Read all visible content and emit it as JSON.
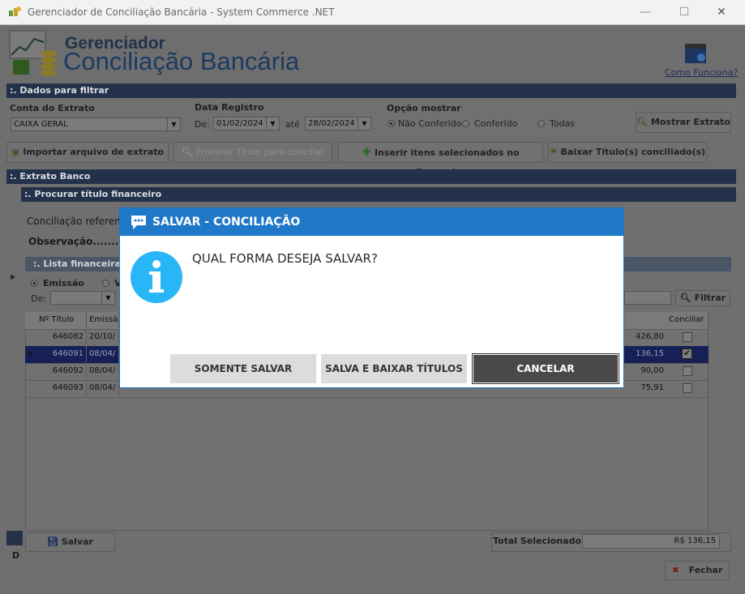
{
  "window": {
    "title": "Gerenciador de Conciliação Bancária - System Commerce .NET",
    "minimize": "—",
    "maximize": "☐",
    "close": "✕"
  },
  "header": {
    "title_line1": "Gerenciador",
    "title_line2": "Conciliação Bancária",
    "help_link": "Como Funciona?"
  },
  "filter": {
    "section": ":. Dados para filtrar",
    "conta_label": "Conta do Extrato",
    "conta_value": "CAIXA GERAL",
    "data_label": "Data Registro",
    "de_label": "De:",
    "de_value": "01/02/2024",
    "ate_label": "até",
    "ate_value": "28/02/2024",
    "opcao_label": "Opção mostrar",
    "options": [
      "Não Conferido",
      "Conferido",
      "Todas"
    ],
    "show_button": "Mostrar Extrato"
  },
  "toolbar": {
    "importar": "Importar arquivo de extrato",
    "procurar": "Procurar Título para conciliar",
    "inserir": "Inserir itens selecionados no financeiro",
    "baixar": "Baixar Título(s) conciliado(s)"
  },
  "extrato": {
    "section": ":. Extrato Banco"
  },
  "procurar": {
    "section": ":. Procurar título financeiro",
    "conciliacao_label": "Conciliação referen",
    "observacao_label": "Observação.........."
  },
  "lista": {
    "section": ":. Lista financeira p",
    "radio1": "Emissão",
    "radio2": "V",
    "de_label": "De:",
    "filtrar": "Filtrar",
    "columns": [
      "Nº Título",
      "Emissã",
      "Conciliar"
    ],
    "rows": [
      {
        "titulo": "646082",
        "emissao": "20/10/",
        "valor": "426,80",
        "checked": false
      },
      {
        "titulo": "646091",
        "emissao": "08/04/",
        "valor": "136,15",
        "checked": true
      },
      {
        "titulo": "646092",
        "emissao": "08/04/",
        "valor": "90,00",
        "checked": false
      },
      {
        "titulo": "646093",
        "emissao": "08/04/",
        "valor": "75,91",
        "checked": false
      }
    ]
  },
  "footer": {
    "salvar": "Salvar",
    "total_label": "Total Selecionado:",
    "total_value": "R$ 136,15",
    "fechar": "Fechar",
    "d_label": "D"
  },
  "dialog": {
    "title": "SALVAR - CONCILIAÇÃO",
    "message": "QUAL FORMA DESEJA SALVAR?",
    "btn_save": "SOMENTE SALVAR",
    "btn_save_lower": "SALVA E BAIXAR TÍTULOS",
    "btn_cancel": "CANCELAR"
  },
  "colors": {
    "dialog_header": "#1f78c8",
    "section_bar": "#23324a",
    "selected_row": "#1a237e",
    "info_icon": "#29b6f6"
  }
}
